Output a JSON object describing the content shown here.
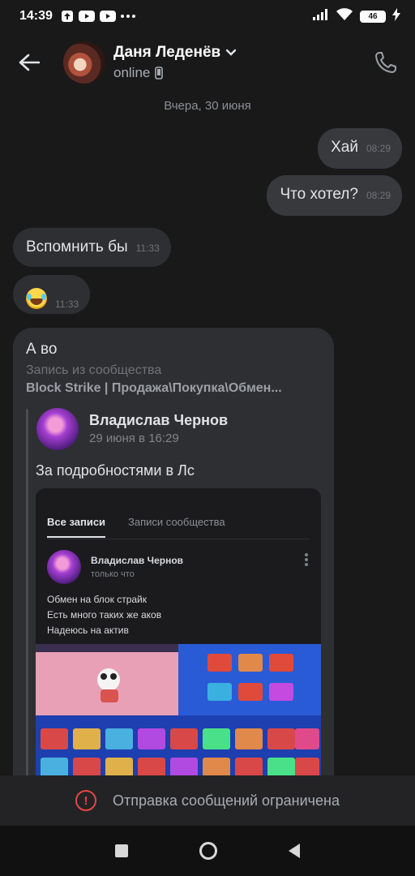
{
  "status_bar": {
    "time": "14:39",
    "battery": "46"
  },
  "header": {
    "peer_name": "Даня Леденёв",
    "peer_status": "online"
  },
  "conversation": {
    "date_separator": "Вчера, 30 июня",
    "messages": [
      {
        "direction": "out",
        "text": "Хай",
        "time": "08:29"
      },
      {
        "direction": "out",
        "text": "Что хотел?",
        "time": "08:29"
      },
      {
        "direction": "in",
        "text": "Вспомнить бы",
        "time": "11:33"
      },
      {
        "direction": "in",
        "emoji": "laughing-with-tears",
        "time": "11:33"
      }
    ],
    "repost": {
      "lead_text": "А во",
      "source_hint": "Запись из сообщества",
      "source_name": "Block Strike | Продажа\\Покупка\\Обмен...",
      "author_name": "Владислав Чернов",
      "author_date": "29 июня в 16:29",
      "text": "За подробностями в Лс",
      "screenshot": {
        "tab_all": "Все записи",
        "tab_community": "Записи сообщества",
        "post_author": "Владислав Чернов",
        "post_time": "только что",
        "post_lines": [
          "Обмен на блок страйк",
          "Есть много таких же аков",
          "Надеюсь на актив"
        ]
      }
    }
  },
  "footer": {
    "restricted_text": "Отправка сообщений ограничена"
  },
  "colors": {
    "background": "#19191a",
    "bubble_in": "#2e2f33",
    "bubble_out": "#38393d",
    "warning": "#e64646"
  }
}
